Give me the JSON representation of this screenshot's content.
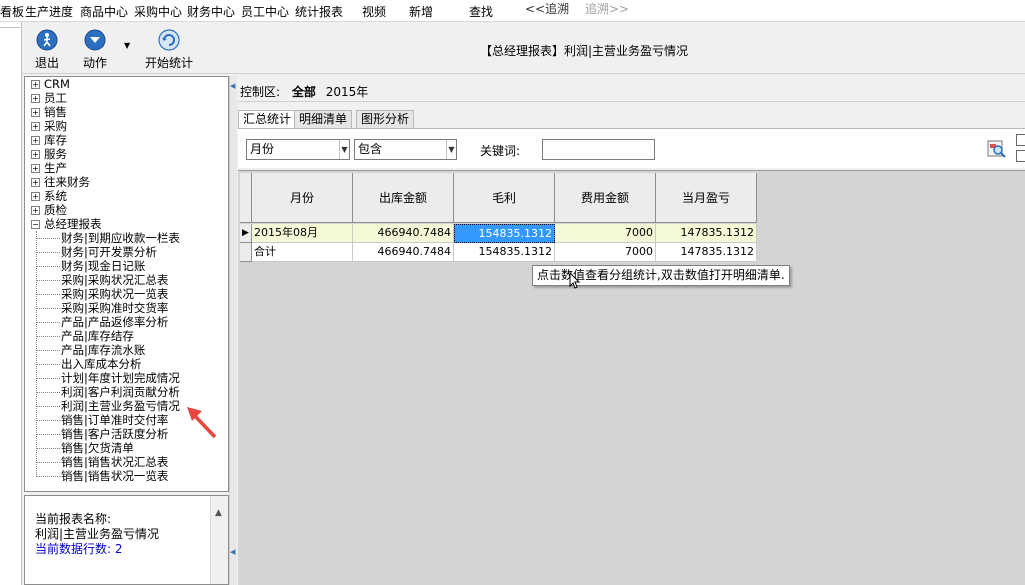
{
  "menu": {
    "items": [
      "看板",
      "生产进度",
      "商品中心",
      "采购中心",
      "财务中心",
      "员工中心",
      "统计报表",
      "视频",
      "新增",
      "查找",
      "<<追溯",
      "追溯>>"
    ]
  },
  "toolbar": {
    "exit_label": "退出",
    "action_label": "动作",
    "start_stats_label": "开始统计",
    "report_title": "【总经理报表】利润|主营业务盈亏情况"
  },
  "tree": {
    "top_items": [
      "CRM",
      "员工",
      "销售",
      "采购",
      "库存",
      "服务",
      "生产",
      "往来财务",
      "系统",
      "质检",
      "总经理报表"
    ],
    "expanded_item": "总经理报表",
    "children": [
      "财务|到期应收款一栏表",
      "财务|可开发票分析",
      "财务|现金日记账",
      "采购|采购状况汇总表",
      "采购|采购状况一览表",
      "采购|采购准时交货率",
      "产品|产品返修率分析",
      "产品|库存结存",
      "产品|库存流水账",
      "出入库成本分析",
      "计划|年度计划完成情况",
      "利润|客户利润贡献分析",
      "利润|主营业务盈亏情况",
      "销售|订单准时交付率",
      "销售|客户活跃度分析",
      "销售|欠货清单",
      "销售|销售状况汇总表",
      "销售|销售状况一览表"
    ]
  },
  "info": {
    "current_report_label": "当前报表名称:",
    "current_report_value": "利润|主营业务盈亏情况",
    "row_count_text": "当前数据行数: 2"
  },
  "control": {
    "label": "控制区:",
    "scope": "全部",
    "year": "2015年"
  },
  "tabs": [
    "汇总统计",
    "明细清单",
    "图形分析"
  ],
  "filters": {
    "field_select": "月份",
    "op_select": "包含",
    "keyword_label": "关键词:",
    "keyword_value": ""
  },
  "grid": {
    "columns": [
      "月份",
      "出库金额",
      "毛利",
      "费用金额",
      "当月盈亏"
    ],
    "rows": [
      [
        "2015年08月",
        "466940.7484",
        "154835.1312",
        "7000",
        "147835.1312"
      ],
      [
        "合计",
        "466940.7484",
        "154835.1312",
        "7000",
        "147835.1312"
      ]
    ]
  },
  "tooltip": "点击数值查看分组统计,双击数值打开明细清单.",
  "colors": {
    "selected_cell": "#3399ff",
    "row_highlight": "#f2f9d6",
    "arrow": "#e8453c"
  }
}
